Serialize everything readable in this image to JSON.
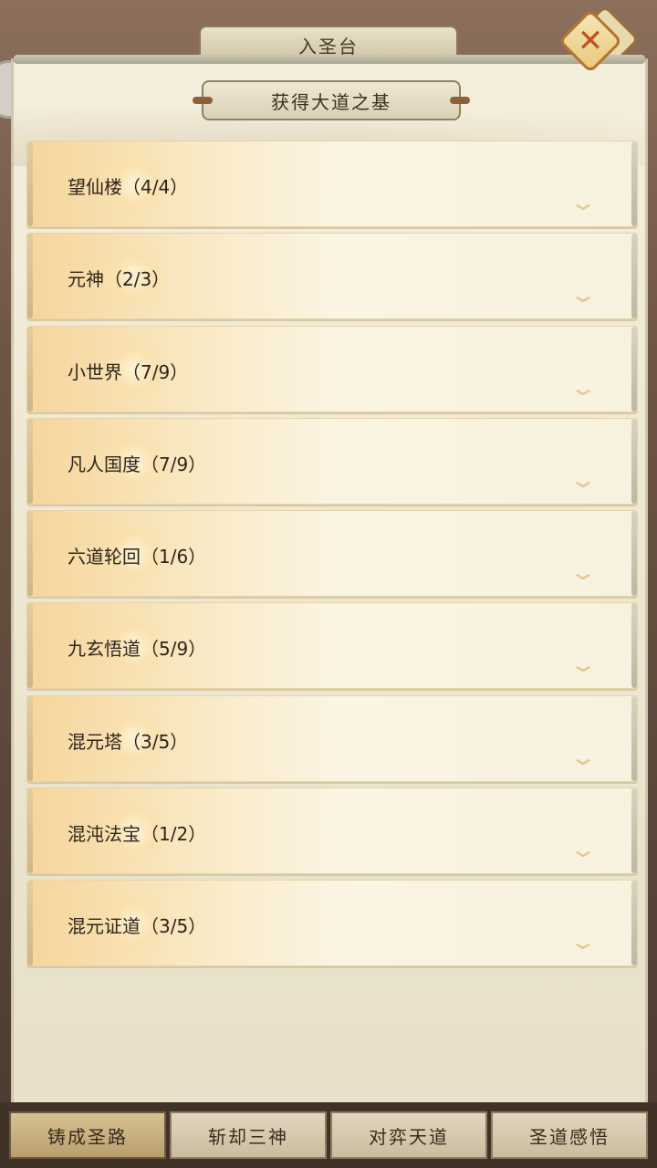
{
  "background": {
    "title": "入圣台",
    "back_icon": "back-arrow-icon"
  },
  "modal": {
    "title": "获得大道之基",
    "close_icon": "close-icon",
    "items": [
      {
        "label": "望仙楼（4/4）"
      },
      {
        "label": "元神（2/3）"
      },
      {
        "label": "小世界（7/9）"
      },
      {
        "label": "凡人国度（7/9）"
      },
      {
        "label": "六道轮回（1/6）"
      },
      {
        "label": "九玄悟道（5/9）"
      },
      {
        "label": "混元塔（3/5）"
      },
      {
        "label": "混沌法宝（1/2）"
      },
      {
        "label": "混元证道（3/5）"
      }
    ]
  },
  "tabs": [
    {
      "label": "铸成圣路",
      "active": true
    },
    {
      "label": "斩却三神",
      "active": false
    },
    {
      "label": "对弈天道",
      "active": false
    },
    {
      "label": "圣道感悟",
      "active": false
    }
  ],
  "colors": {
    "accent": "#c0501f",
    "panel": "#f4eedc",
    "item_gold": "#f6d59b",
    "tabbar": "#413227"
  }
}
